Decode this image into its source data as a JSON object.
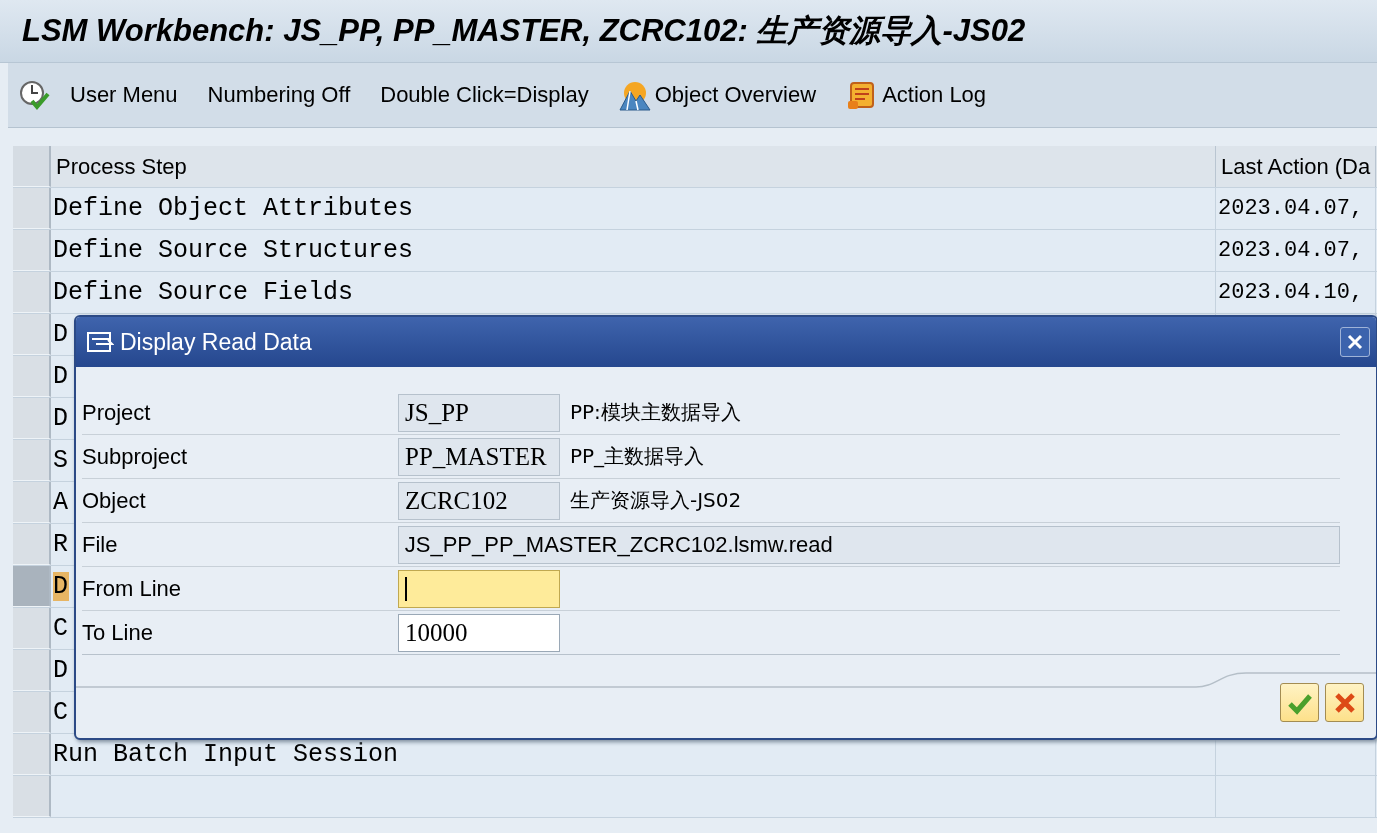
{
  "window": {
    "title": "LSM Workbench: JS_PP, PP_MASTER, ZCRC102: 生产资源导入-JS02"
  },
  "toolbar": [
    {
      "label": "User Menu",
      "kind": "clock"
    },
    {
      "label": "Numbering Off",
      "kind": "plain"
    },
    {
      "label": "Double Click=Display",
      "kind": "plain"
    },
    {
      "label": "Object Overview",
      "kind": "mountain"
    },
    {
      "label": "Action Log",
      "kind": "scroll"
    }
  ],
  "table": {
    "columns": [
      "Process Step",
      "Last Action (Da"
    ],
    "rows": [
      {
        "step": "Define Object Attributes",
        "last_action": "2023.04.07,",
        "selected": false
      },
      {
        "step": "Define Source Structures",
        "last_action": "2023.04.07,",
        "selected": false
      },
      {
        "step": "Define Source Fields",
        "last_action": "2023.04.10,",
        "selected": false
      },
      {
        "step": "D",
        "selected": false
      },
      {
        "step": "D",
        "selected": false
      },
      {
        "step": "D",
        "selected": false
      },
      {
        "step": "S",
        "selected": false
      },
      {
        "step": "A",
        "selected": false
      },
      {
        "step": "R",
        "selected": false
      },
      {
        "step": "D",
        "selected": true
      },
      {
        "step": "C",
        "selected": false
      },
      {
        "step": "D",
        "selected": false
      },
      {
        "step": "C",
        "selected": false
      },
      {
        "step": "Run Batch Input Session",
        "selected": false
      }
    ]
  },
  "dialog": {
    "title": "Display Read Data",
    "fields": [
      {
        "label": "Project",
        "kind": "display",
        "value": "JS_PP",
        "description": "PP:模块主数据导入"
      },
      {
        "label": "Subproject",
        "kind": "display",
        "value": "PP_MASTER",
        "description": "PP_主数据导入"
      },
      {
        "label": "Object",
        "kind": "display",
        "value": "ZCRC102",
        "description": "生产资源导入-JS02"
      },
      {
        "label": "File",
        "kind": "wide",
        "value": "JS_PP_PP_MASTER_ZCRC102.lsmw.read"
      },
      {
        "label": "From Line",
        "kind": "input",
        "focused": true
      },
      {
        "label": "To Line",
        "kind": "input",
        "value": "10000",
        "focused": false
      }
    ],
    "buttons": [
      {
        "kind": "confirm"
      },
      {
        "kind": "cancel"
      }
    ]
  }
}
